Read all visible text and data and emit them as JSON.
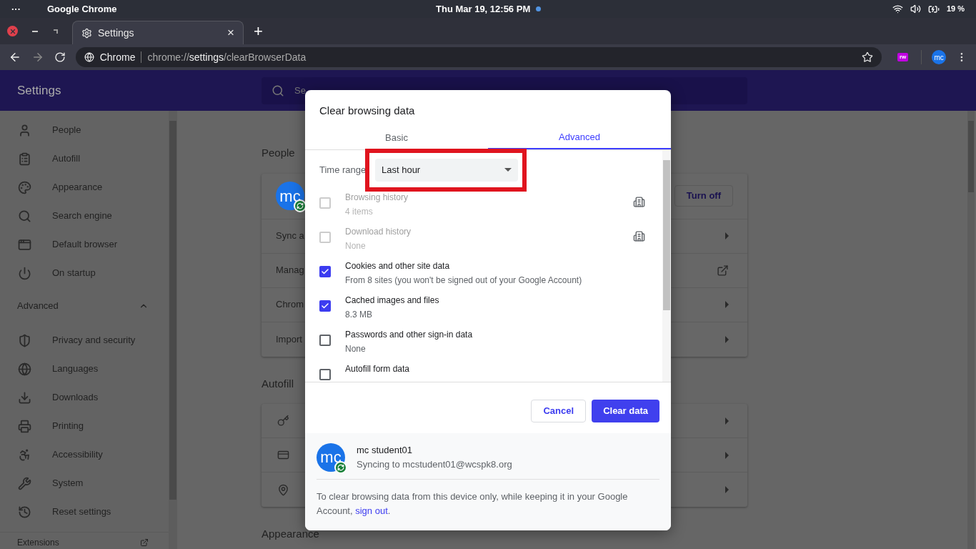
{
  "os_bar": {
    "menu": "···",
    "app": "Google Chrome",
    "clock": "Thu Mar 19, 12:56 PM",
    "battery": "19 %"
  },
  "browser": {
    "tab": {
      "title": "Settings",
      "close": "×"
    },
    "new_tab": "+",
    "address": {
      "site": "Chrome",
      "scheme": "chrome://",
      "host": "settings",
      "path": "/clearBrowserData"
    },
    "extension": "rw",
    "avatar": "mc"
  },
  "settings": {
    "title": "Settings",
    "search": {
      "placeholder": "Se"
    },
    "sidebar": {
      "items": [
        {
          "label": "People"
        },
        {
          "label": "Autofill"
        },
        {
          "label": "Appearance"
        },
        {
          "label": "Search engine"
        },
        {
          "label": "Default browser"
        },
        {
          "label": "On startup"
        }
      ],
      "advanced": {
        "label": "Advanced",
        "expanded": true,
        "items": [
          {
            "label": "Privacy and security"
          },
          {
            "label": "Languages"
          },
          {
            "label": "Downloads"
          },
          {
            "label": "Printing"
          },
          {
            "label": "Accessibility"
          },
          {
            "label": "System"
          },
          {
            "label": "Reset settings"
          }
        ]
      },
      "extensions": "Extensions"
    },
    "people": {
      "heading": "People",
      "avatar": "mc",
      "turn_off": "Turn off",
      "rows": [
        {
          "label": "Sync a",
          "kind": "arrow"
        },
        {
          "label": "Manag",
          "kind": "external"
        },
        {
          "label": "Chrom",
          "kind": "arrow"
        },
        {
          "label": "Import",
          "kind": "arrow"
        }
      ]
    },
    "autofill": {
      "heading": "Autofill",
      "rows": [
        {
          "kind": "arrow"
        },
        {
          "kind": "arrow"
        },
        {
          "kind": "arrow"
        }
      ]
    },
    "appearance": {
      "heading": "Appearance"
    }
  },
  "dialog": {
    "title": "Clear browsing data",
    "tabs": [
      {
        "label": "Basic",
        "selected": false
      },
      {
        "label": "Advanced",
        "selected": true
      }
    ],
    "time_range": {
      "label": "Time range",
      "value": "Last hour"
    },
    "items": [
      {
        "title": "Browsing history",
        "subtitle": "4 items",
        "checked": false,
        "disabled": true,
        "managed": true
      },
      {
        "title": "Download history",
        "subtitle": "None",
        "checked": false,
        "disabled": true,
        "managed": true
      },
      {
        "title": "Cookies and other site data",
        "subtitle": "From 8 sites (you won't be signed out of your Google Account)",
        "checked": true,
        "disabled": false,
        "managed": false
      },
      {
        "title": "Cached images and files",
        "subtitle": "8.3 MB",
        "checked": true,
        "disabled": false,
        "managed": false
      },
      {
        "title": "Passwords and other sign-in data",
        "subtitle": "None",
        "checked": false,
        "disabled": false,
        "managed": false
      },
      {
        "title": "Autofill form data",
        "checked": false,
        "disabled": false,
        "managed": false
      }
    ],
    "cancel": "Cancel",
    "clear": "Clear data",
    "account": {
      "avatar": "mc",
      "name": "mc student01",
      "email": "Syncing to mcstudent01@wcspk8.org"
    },
    "note": "To clear browsing data from this device only, while keeping it in your Google Account,",
    "note_link": "sign out",
    "note_end": "."
  }
}
